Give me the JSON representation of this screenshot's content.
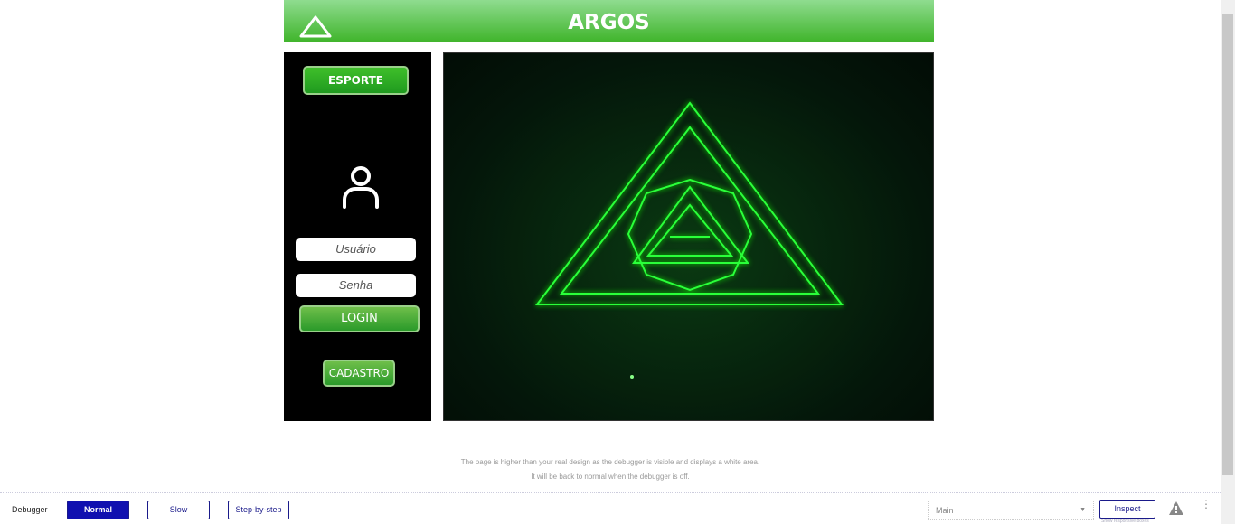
{
  "header": {
    "title": "ARGOS",
    "logo_icon": "triangle-icon"
  },
  "sidebar": {
    "esporte": "ESPORTE",
    "user_icon": "user-icon",
    "username_placeholder": "Usuário",
    "password_placeholder": "Senha",
    "login": "LOGIN",
    "cadastro": "CADASTRO"
  },
  "note": {
    "line1": "The page is higher than your real design as the debugger is visible and displays a white area.",
    "line2": "It will be back to normal when the debugger is off."
  },
  "debugger": {
    "label": "Debugger",
    "normal": "Normal",
    "slow": "Slow",
    "step": "Step-by-step",
    "select": "Main",
    "inspect": "Inspect",
    "inspect_sub": "Show responsive boxes"
  },
  "colors": {
    "accent": "#3fb42a",
    "debug": "#1010b0"
  }
}
